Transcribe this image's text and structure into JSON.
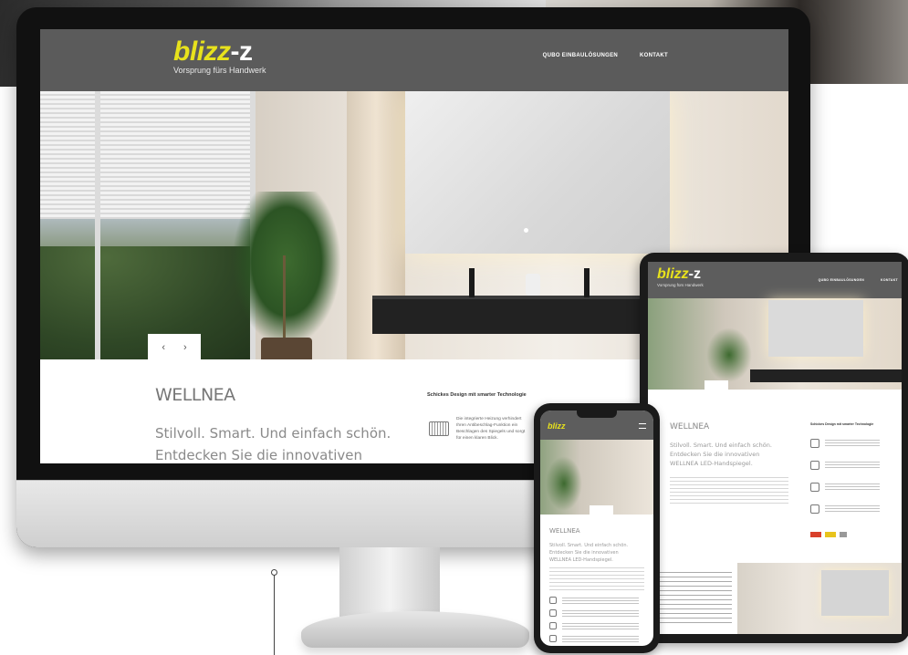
{
  "site": {
    "logo_main": "blizz",
    "logo_suffix": "-z",
    "tagline": "Vorsprung fürs Handwerk",
    "nav": [
      {
        "label": "QUBO EINBAULÖSUNGEN"
      },
      {
        "label": "KONTAKT"
      }
    ]
  },
  "hero": {
    "prev_label": "‹",
    "next_label": "›"
  },
  "content": {
    "brand": "WELLNEA",
    "subtitle_line1": "Stilvoll. Smart. Und einfach schön.",
    "subtitle_line2": "Entdecken Sie die innovativen",
    "feature_heading": "Schickes Design mit smarter Technologie",
    "feature_text": "Die integrierte Heizung verhindert Ihren Antibeschlag-Funktion ein Beschlagen des Spiegels und sorgt für einen klaren Blick."
  },
  "tablet": {
    "logo_main": "blizz",
    "logo_suffix": "-z",
    "tagline": "Vorsprung fürs Handwerk",
    "brand": "WELLNEA",
    "line1": "Stilvoll. Smart. Und einfach schön.",
    "line2": "Entdecken Sie die innovativen",
    "line3": "WELLNEA LED-Handspiegel."
  },
  "phone": {
    "logo": "blizz",
    "brand": "WELLNEA",
    "line1": "Stilvoll. Smart. Und einfach schön.",
    "line2": "Entdecken Sie die innovativen",
    "line3": "WELLNEA LED-Handspiegel."
  },
  "colors": {
    "brand_yellow": "#e8e21c",
    "header_gray": "#5b5b5b"
  }
}
